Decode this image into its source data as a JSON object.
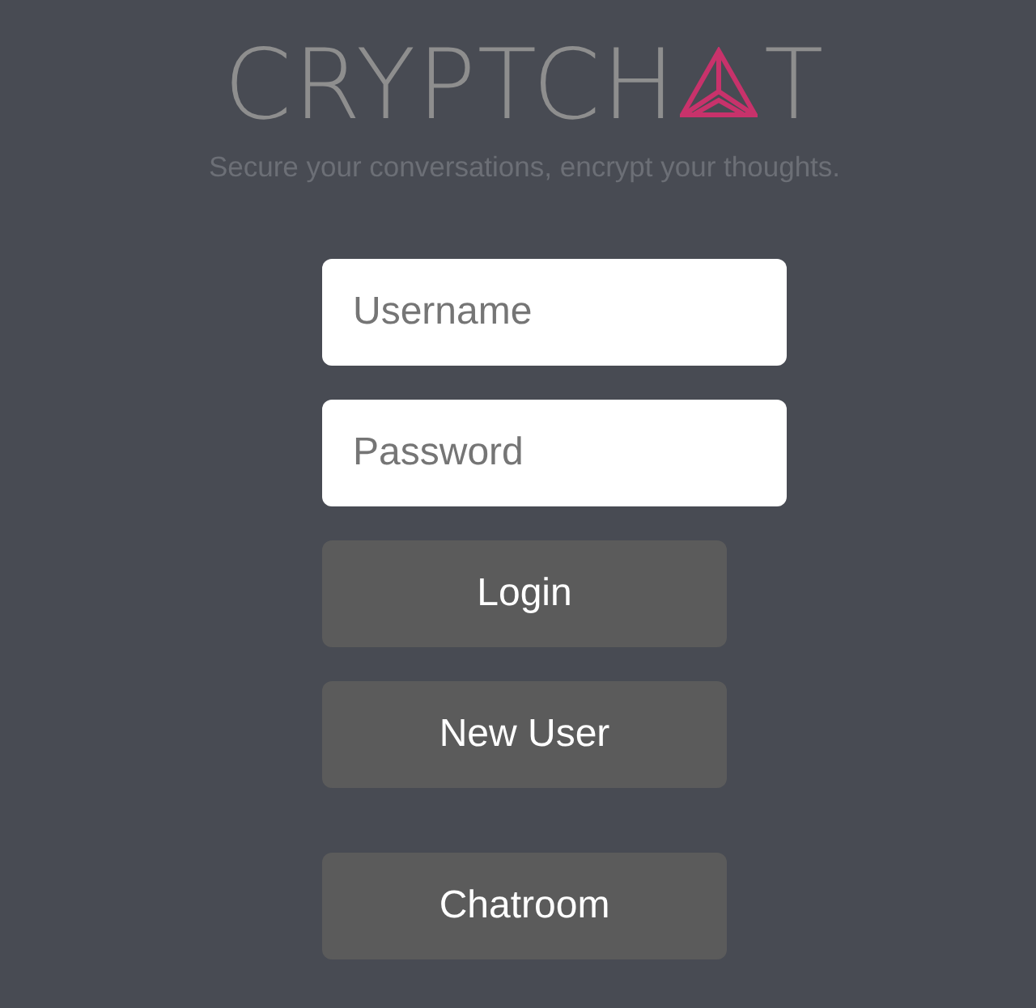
{
  "logo": {
    "text_start": "CRYPTCH",
    "text_end": "T"
  },
  "tagline": "Secure your conversations, encrypt your thoughts.",
  "fields": [
    {
      "placeholder": "Username"
    },
    {
      "placeholder": "Password"
    }
  ],
  "buttons": [
    {
      "label": "Login"
    },
    {
      "label": "New User"
    }
  ],
  "footer_button": {
    "label": "Chatroom"
  }
}
